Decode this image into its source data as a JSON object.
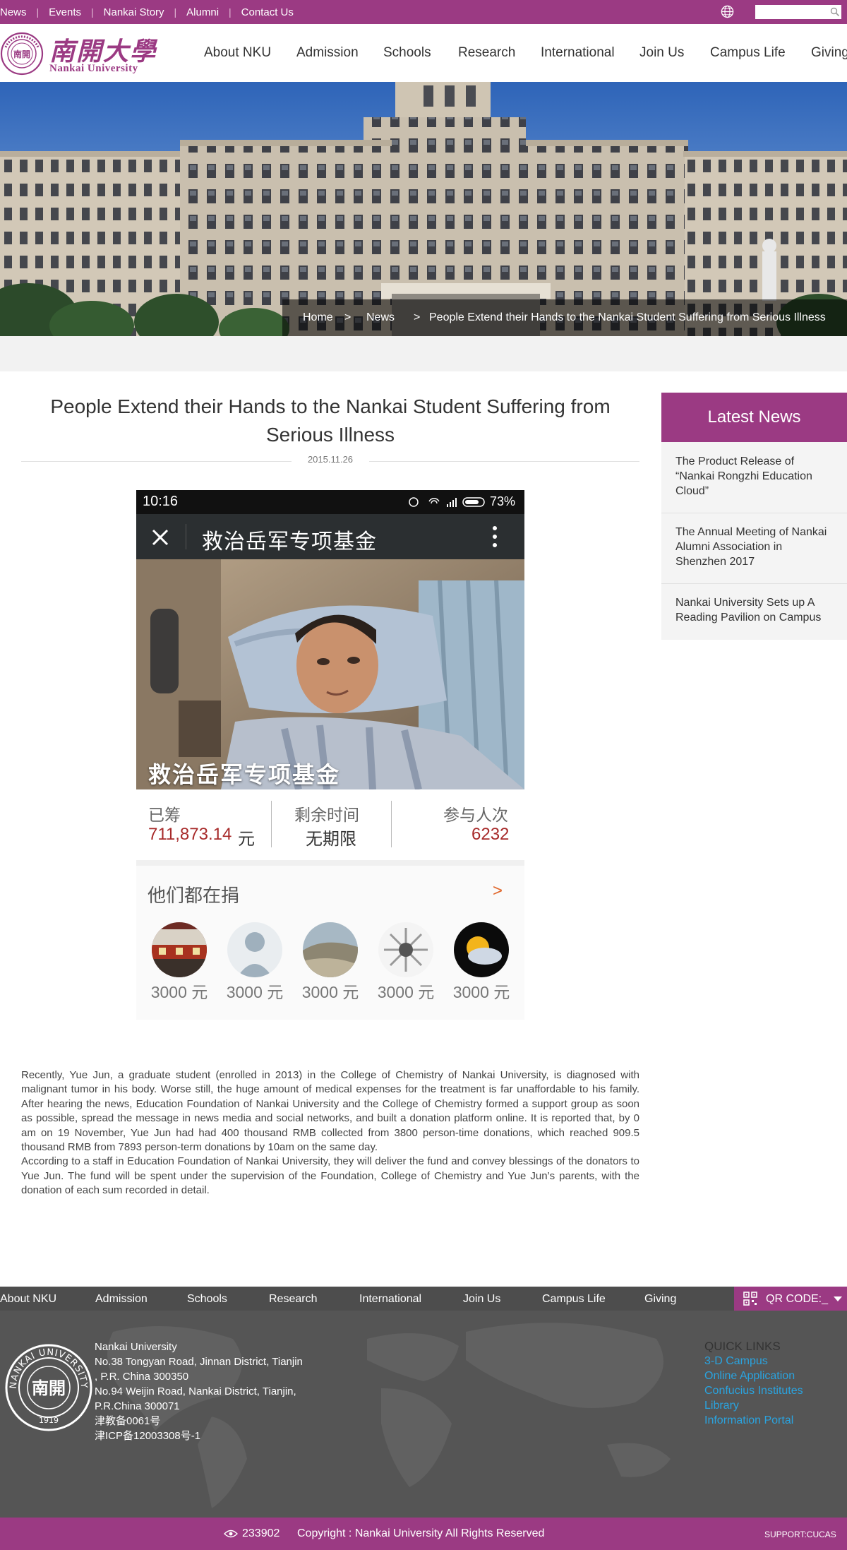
{
  "topbar": {
    "links": [
      "News",
      "Events",
      "Nankai Story",
      "Alumni",
      "Contact Us"
    ],
    "search_placeholder": ""
  },
  "header": {
    "logo_cn": "南開大學",
    "logo_en": "Nankai University",
    "nav": [
      "About NKU",
      "Admission",
      "Schools",
      "Research",
      "International",
      "Join Us",
      "Campus Life",
      "Giving"
    ]
  },
  "breadcrumb": {
    "home": "Home",
    "sep": ">",
    "section": "News",
    "current": "People Extend their Hands to the Nankai Student Suffering from Serious Illness"
  },
  "article": {
    "title": "People Extend their Hands to the Nankai Student Suffering from Serious Illness",
    "date": "2015.11.26",
    "paragraphs": [
      "Recently, Yue Jun, a graduate student (enrolled in 2013) in the College of Chemistry of Nankai University, is diagnosed with malignant tumor in his body. Worse still, the huge amount of medical expenses for the treatment is far unaffordable to his family. After hearing the news, Education Foundation of Nankai University and the College of Chemistry formed a support group as soon as possible, spread the message in news media and social networks, and built a donation platform online. It is reported that, by 0 am on 19 November, Yue Jun had had 400 thousand RMB collected from 3800 person-time donations, which reached 909.5 thousand RMB from 7893 person-term donations by 10am on the same day.",
      "According to a staff in Education Foundation of Nankai University, they will deliver the fund and convey blessings of the donators to Yue Jun. The fund will be spent under the supervision of the Foundation, College of Chemistry and Yue Jun’s parents, with the donation of each sum recorded in detail."
    ]
  },
  "phone": {
    "time": "10:16",
    "battery": "73%",
    "title": "救治岳军专项基金",
    "caption": "救治岳军专项基金",
    "raised_label": "已筹",
    "raised_value": "711,873.14",
    "raised_unit": "元",
    "time_label": "剩余时间",
    "time_value": "无期限",
    "people_label": "参与人次",
    "people_value": "6232",
    "donors_title": "他们都在捐",
    "donors_arrow": ">",
    "donors": [
      "3000 元",
      "3000 元",
      "3000 元",
      "3000 元",
      "3000 元"
    ]
  },
  "sidebar": {
    "title": "Latest News",
    "items": [
      "The Product Release of “Nankai Rongzhi Education Cloud”",
      "The Annual Meeting of Nankai Alumni Association in Shenzhen 2017",
      "Nankai University Sets up A Reading Pavilion on Campus"
    ]
  },
  "footer": {
    "nav": [
      "About NKU",
      "Admission",
      "Schools",
      "Research",
      "International",
      "Join Us",
      "Campus Life",
      "Giving"
    ],
    "qr_label": "QR CODE:_",
    "address_lines": [
      "Nankai University",
      "No.38 Tongyan Road, Jinnan District, Tianjin",
      ", P.R. China 300350",
      "No.94 Weijin Road,  Nankai District, Tianjin,",
      "P.R.China  300071",
      "津教备0061号",
      "津ICP备12003308号-1"
    ],
    "quick_links_title": "QUICK LINKS",
    "quick_links": [
      "3-D Campus",
      "Online Application",
      "Confucius Institutes",
      "Library",
      "Information Portal"
    ],
    "visit_count": "233902",
    "copyright": "Copyright : Nankai University All Rights Reserved",
    "support": "SUPPORT:CUCAS"
  },
  "colors": {
    "brand_purple": "#9b3a83",
    "footer_gray": "#555555",
    "link_blue": "#2aa3df",
    "amount_red": "#a72a2a"
  }
}
